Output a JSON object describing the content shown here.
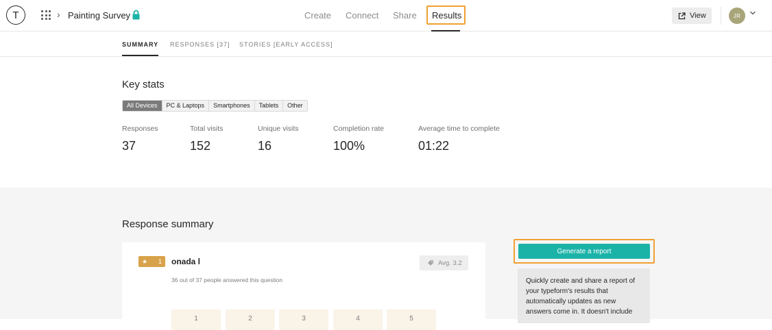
{
  "header": {
    "logo_letter": "T",
    "workspace_title": "Painting Survey",
    "nav": [
      {
        "label": "Create"
      },
      {
        "label": "Connect"
      },
      {
        "label": "Share"
      },
      {
        "label": "Results"
      }
    ],
    "active_nav": "Results",
    "view_label": "View",
    "avatar_initials": "JR"
  },
  "subtabs": [
    {
      "label": "SUMMARY"
    },
    {
      "label": "RESPONSES [37]"
    },
    {
      "label": "STORIES [EARLY ACCESS]"
    }
  ],
  "key_stats": {
    "title": "Key stats",
    "devices": [
      "All Devices",
      "PC & Laptops",
      "Smartphones",
      "Tablets",
      "Other"
    ],
    "selected_device": "All Devices",
    "stats": [
      {
        "label": "Responses",
        "value": "37"
      },
      {
        "label": "Total visits",
        "value": "152"
      },
      {
        "label": "Unique visits",
        "value": "16"
      },
      {
        "label": "Completion rate",
        "value": "100%"
      },
      {
        "label": "Average time to complete",
        "value": "01:22"
      }
    ]
  },
  "response_summary": {
    "title": "Response summary",
    "question": {
      "badge_icon": "★",
      "number": "1",
      "title": "onada l",
      "answered_text": "36 out of 37 people answered this question",
      "avg_label": "Avg. 3.2",
      "scale": [
        "1",
        "2",
        "3",
        "4",
        "5"
      ]
    },
    "generate_button": "Generate a report",
    "report_text": "Quickly create and share a report of your typeform's results that automatically updates as new answers come in. It doesn't include"
  },
  "colors": {
    "accent_teal": "#1bb3a8",
    "highlight_orange": "#f0a030",
    "badge_gold": "#d8a24a",
    "avatar": "#a8a57a"
  }
}
